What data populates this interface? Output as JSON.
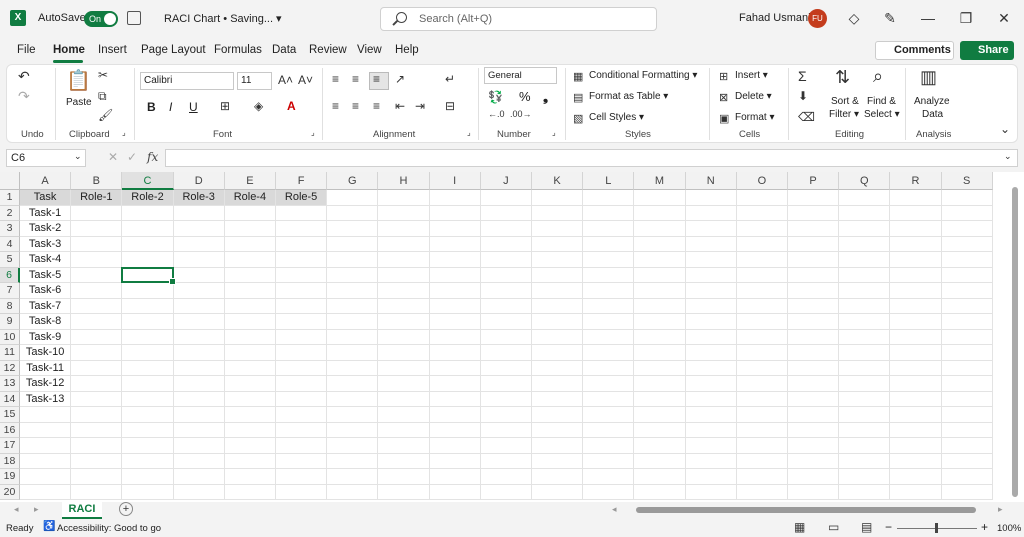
{
  "titlebar": {
    "autosave_label": "AutoSave",
    "autosave_state": "On",
    "doc_title": "RACI Chart • Saving... ▾",
    "search_placeholder": "Search (Alt+Q)",
    "user_name": "Fahad Usmani",
    "user_initials": "FU"
  },
  "menu": {
    "tabs": [
      "File",
      "Home",
      "Insert",
      "Page Layout",
      "Formulas",
      "Data",
      "Review",
      "View",
      "Help"
    ],
    "comments_label": "Comments",
    "share_label": "Share"
  },
  "ribbon": {
    "groups": {
      "undo": "Undo",
      "clipboard": "Clipboard",
      "font": "Font",
      "alignment": "Alignment",
      "number": "Number",
      "styles": "Styles",
      "cells": "Cells",
      "editing": "Editing",
      "analysis": "Analysis"
    },
    "paste_label": "Paste",
    "font_name": "Calibri",
    "font_size": "11",
    "number_format": "General",
    "conditional_formatting": "Conditional Formatting ▾",
    "format_as_table": "Format as Table ▾",
    "cell_styles": "Cell Styles ▾",
    "insert_label": "Insert ▾",
    "delete_label": "Delete ▾",
    "format_label": "Format ▾",
    "sort_filter_1": "Sort &",
    "sort_filter_2": "Filter ▾",
    "find_select_1": "Find &",
    "find_select_2": "Select ▾",
    "analyze_1": "Analyze",
    "analyze_2": "Data",
    "bold": "B",
    "italic": "I",
    "underline": "U",
    "percent": "%",
    "comma": "❟"
  },
  "formula_bar": {
    "name_box": "C6",
    "fx": "fx",
    "value": ""
  },
  "sheet": {
    "columns": [
      "A",
      "B",
      "C",
      "D",
      "E",
      "F",
      "G",
      "H",
      "I",
      "J",
      "K",
      "L",
      "M",
      "N",
      "O",
      "P",
      "Q",
      "R",
      "S"
    ],
    "rows": [
      "1",
      "2",
      "3",
      "4",
      "5",
      "6",
      "7",
      "8",
      "9",
      "10",
      "11",
      "12",
      "13",
      "14",
      "15",
      "16",
      "17",
      "18",
      "19",
      "20"
    ],
    "header_row": [
      "Task",
      "Role-1",
      "Role-2",
      "Role-3",
      "Role-4",
      "Role-5"
    ],
    "tasks": [
      "Task-1",
      "Task-2",
      "Task-3",
      "Task-4",
      "Task-5",
      "Task-6",
      "Task-7",
      "Task-8",
      "Task-9",
      "Task-10",
      "Task-11",
      "Task-12",
      "Task-13"
    ],
    "active_cell": "C6"
  },
  "sheet_tabs": {
    "active": "RACI",
    "add_label": "+"
  },
  "status": {
    "ready": "Ready",
    "accessibility": "Accessibility: Good to go",
    "zoom": "100%",
    "zoom_minus": "−",
    "zoom_plus": "+"
  },
  "colors": {
    "accent": "#107c41",
    "header_fill": "#d9d9d9",
    "avatar": "#c43c1c"
  }
}
